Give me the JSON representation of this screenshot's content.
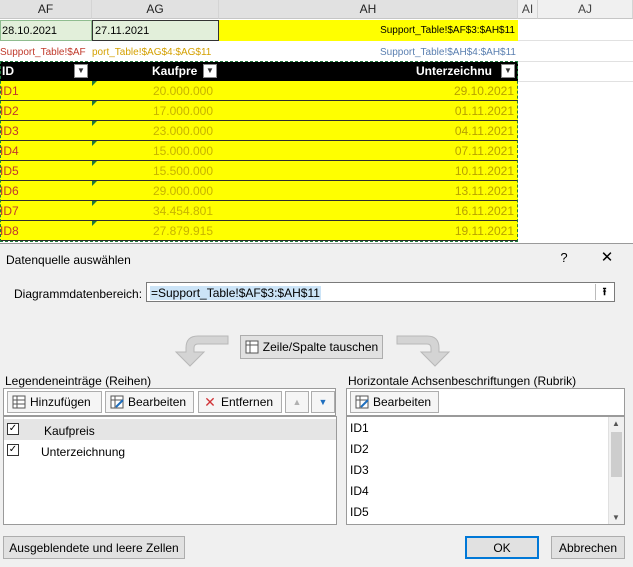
{
  "sheet": {
    "columns": [
      "AF",
      "AG",
      "AH",
      "AI",
      "AJ"
    ],
    "top_row": {
      "af": "28.10.2021",
      "ag": "27.11.2021",
      "ah": "Support_Table!$AF$3:$AH$11"
    },
    "ref_row": {
      "af": "Support_Table!$AF",
      "ag": "port_Table!$AG$4:$AG$11",
      "ah": "Support_Table!$AH$4:$AH$11"
    },
    "headers": {
      "id": "ID",
      "price": "Kaufpre",
      "date": "Unterzeichnu"
    },
    "rows": [
      {
        "id": "ID1",
        "price": "20.000.000",
        "date": "29.10.2021"
      },
      {
        "id": "ID2",
        "price": "17.000.000",
        "date": "01.11.2021"
      },
      {
        "id": "ID3",
        "price": "23.000.000",
        "date": "04.11.2021"
      },
      {
        "id": "ID4",
        "price": "15.000.000",
        "date": "07.11.2021"
      },
      {
        "id": "ID5",
        "price": "15.500.000",
        "date": "10.11.2021"
      },
      {
        "id": "ID6",
        "price": "29.000.000",
        "date": "13.11.2021"
      },
      {
        "id": "ID7",
        "price": "34.454.801",
        "date": "16.11.2021"
      },
      {
        "id": "ID8",
        "price": "27.879.915",
        "date": "19.11.2021"
      }
    ]
  },
  "dialog": {
    "title": "Datenquelle auswählen",
    "help": "?",
    "close": "✕",
    "range_label": "Diagrammdatenbereich:",
    "range_value": "=Support_Table!$AF$3:$AH$11",
    "switch_label": "Zeile/Spalte tauschen",
    "legend": {
      "title": "Legendeneinträge (Reihen)",
      "add": "Hinzufügen",
      "edit": "Bearbeiten",
      "remove": "Entfernen",
      "up": "▲",
      "down": "▼",
      "items": [
        "Kaufpreis",
        "Unterzeichnung"
      ]
    },
    "axis": {
      "title": "Horizontale Achsenbeschriftungen (Rubrik)",
      "edit": "Bearbeiten",
      "items": [
        "ID1",
        "ID2",
        "ID3",
        "ID4",
        "ID5"
      ]
    },
    "hidden_cells": "Ausgeblendete und leere Zellen",
    "ok": "OK",
    "cancel": "Abbrechen"
  },
  "colors": {
    "highlight": "#ffff00",
    "accent": "#0078d7",
    "id_red": "#c0392b"
  }
}
